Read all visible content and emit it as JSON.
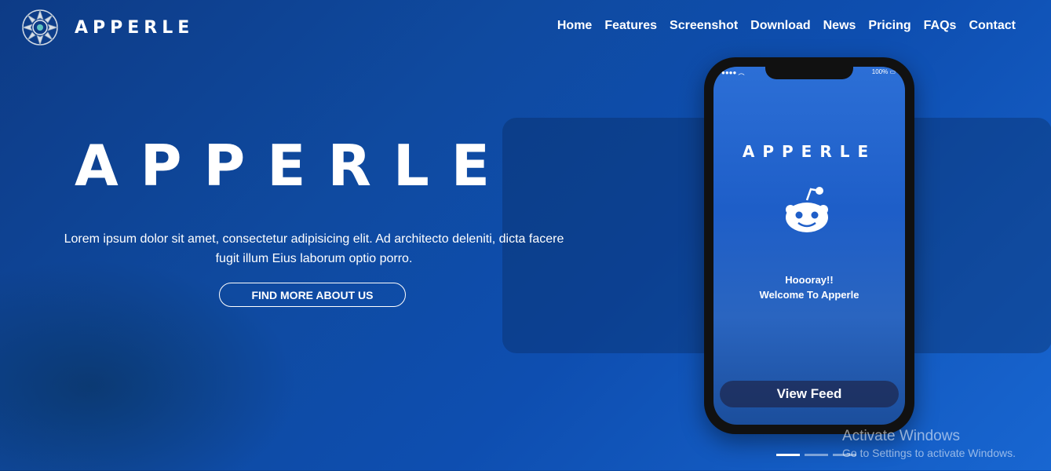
{
  "brand": {
    "logo_icon": "mandala-logo-icon",
    "name": "APPERLE"
  },
  "nav": [
    "Home",
    "Features",
    "Screenshot",
    "Download",
    "News",
    "Pricing",
    "FAQs",
    "Contact"
  ],
  "hero": {
    "title": "APPERLE",
    "text": "Lorem ipsum dolor sit amet, consectetur adipisicing elit. Ad architecto deleniti, dicta facere fugit illum Eius laborum optio porro.",
    "button_label": "FIND MORE ABOUT US"
  },
  "phone": {
    "status_battery": "100%",
    "app_title": "APPERLE",
    "mascot_icon": "reddit-alien-icon",
    "message_line1": "Hoooray!!",
    "message_line2": "Welcome To Apperle",
    "feed_button": "View Feed"
  },
  "slider": {
    "count": 3,
    "active_index": 0
  },
  "watermark": {
    "line1": "Activate Windows",
    "line2": "Go to Settings to activate Windows."
  },
  "colors": {
    "background": "#0f4aa0",
    "accent": "#1866d1"
  }
}
